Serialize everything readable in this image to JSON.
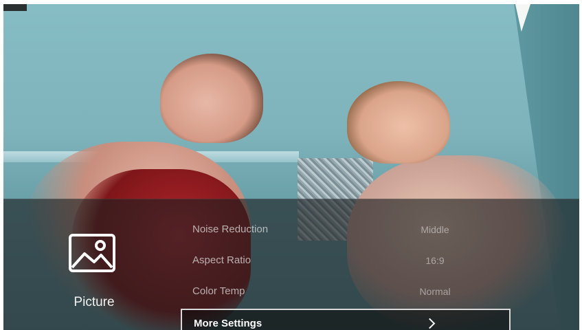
{
  "osd": {
    "category": {
      "icon": "picture-icon",
      "label": "Picture"
    },
    "menu": [
      {
        "label": "Noise Reduction",
        "value": "Middle"
      },
      {
        "label": "Aspect Ratio",
        "value": "16:9"
      },
      {
        "label": "Color Temp",
        "value": "Normal"
      },
      {
        "label": "More Settings",
        "icon": "chevron-right-icon",
        "selected": true
      }
    ]
  },
  "colors": {
    "overlay": "#1c1e20",
    "selected_border": "#d9d9d9",
    "text": "#f1f1f1"
  }
}
